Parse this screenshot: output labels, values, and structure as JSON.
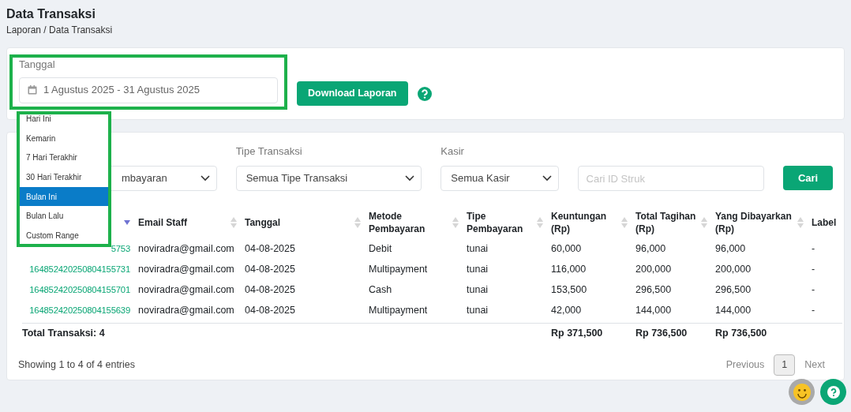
{
  "page": {
    "title": "Data Transaksi",
    "breadcrumb": "Laporan / Data Transaksi"
  },
  "date_filter": {
    "label": "Tanggal",
    "value": "1 Agustus 2025 - 31 Agustus 2025",
    "download_button": "Download Laporan"
  },
  "date_ranges": [
    {
      "label": "Hari Ini",
      "selected": false
    },
    {
      "label": "Kemarin",
      "selected": false
    },
    {
      "label": "7 Hari Terakhir",
      "selected": false
    },
    {
      "label": "30 Hari Terakhir",
      "selected": false
    },
    {
      "label": "Bulan Ini",
      "selected": true
    },
    {
      "label": "Bulan Lalu",
      "selected": false
    },
    {
      "label": "Custom Range",
      "selected": false
    }
  ],
  "filters": [
    {
      "kind": "select",
      "value": "mbayaran"
    },
    {
      "kind": "select",
      "label": "Tipe Transaksi",
      "value": "Semua Tipe Transaksi"
    },
    {
      "kind": "select",
      "label": "Kasir",
      "value": "Semua Kasir"
    },
    {
      "kind": "search",
      "placeholder": "Cari ID Struk"
    }
  ],
  "search_button": "Cari",
  "table": {
    "columns": [
      "",
      "Email Staff",
      "Tanggal",
      "Metode Pembayaran",
      "Tipe Pembayaran",
      "Keuntungan (Rp)",
      "Total Tagihan (Rp)",
      "Yang Dibayarkan (Rp)",
      "Label"
    ],
    "rows": [
      [
        "5753",
        "noviradra@gmail.com",
        "04-08-2025",
        "Debit",
        "tunai",
        "60,000",
        "96,000",
        "96,000",
        "-"
      ],
      [
        "164852420250804155731",
        "noviradra@gmail.com",
        "04-08-2025",
        "Multipayment",
        "tunai",
        "116,000",
        "200,000",
        "200,000",
        "-"
      ],
      [
        "164852420250804155701",
        "noviradra@gmail.com",
        "04-08-2025",
        "Cash",
        "tunai",
        "153,500",
        "296,500",
        "296,500",
        "-"
      ],
      [
        "164852420250804155639",
        "noviradra@gmail.com",
        "04-08-2025",
        "Multipayment",
        "tunai",
        "42,000",
        "144,000",
        "144,000",
        "-"
      ]
    ],
    "total": {
      "label": "Total Transaksi: 4",
      "keuntungan": "Rp 371,500",
      "tagihan": "Rp 736,500",
      "dibayarkan": "Rp 736,500"
    }
  },
  "entries_info": "Showing 1 to 4 of 4 entries",
  "pagination": {
    "previous": "Previous",
    "pages": [
      {
        "label": "1",
        "selected": true
      }
    ],
    "next": "Next"
  }
}
